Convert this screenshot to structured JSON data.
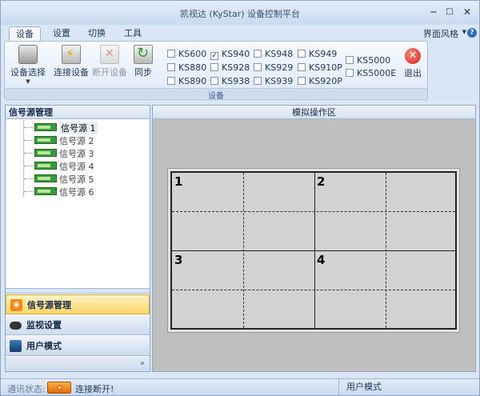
{
  "window": {
    "title": "凯视达 (KyStar) 设备控制平台",
    "min_glyph": "─",
    "max_glyph": "□",
    "close_glyph": "✕"
  },
  "ribbon": {
    "tabs": [
      "设备",
      "设置",
      "切换",
      "工具"
    ],
    "active_tab": 0,
    "skin_label": "界面风格",
    "help_glyph": "?",
    "buttons": {
      "select_device": "设备选择",
      "connect": "连接设备",
      "disconnect": "断开设备",
      "sync": "同步",
      "exit": "退出"
    },
    "group_label": "设备",
    "models": [
      {
        "label": "KS600",
        "checked": false
      },
      {
        "label": "KS940",
        "checked": true
      },
      {
        "label": "KS948",
        "checked": false
      },
      {
        "label": "KS949",
        "checked": false
      },
      {
        "label": "KS880",
        "checked": false
      },
      {
        "label": "KS928",
        "checked": false
      },
      {
        "label": "KS929",
        "checked": false
      },
      {
        "label": "KS910P",
        "checked": false
      },
      {
        "label": "KS890",
        "checked": false
      },
      {
        "label": "KS938",
        "checked": false
      },
      {
        "label": "KS939",
        "checked": false
      },
      {
        "label": "KS920P",
        "checked": false
      },
      {
        "label": "KS5000",
        "checked": false
      },
      {
        "label": "KS5000E",
        "checked": false
      }
    ]
  },
  "left_panel": {
    "title": "信号源管理",
    "sources": [
      "信号源 1",
      "信号源 2",
      "信号源 3",
      "信号源 4",
      "信号源 5",
      "信号源 6"
    ],
    "selected_source": 0,
    "nav": [
      "信号源管理",
      "监视设置",
      "用户模式"
    ],
    "active_nav": 0,
    "more_glyph": "»"
  },
  "right_panel": {
    "title": "模拟操作区",
    "zones": [
      "1",
      "2",
      "3",
      "4"
    ]
  },
  "status": {
    "label": "通讯状态:",
    "connection_text": "连接断开!",
    "mode": "用户模式"
  }
}
